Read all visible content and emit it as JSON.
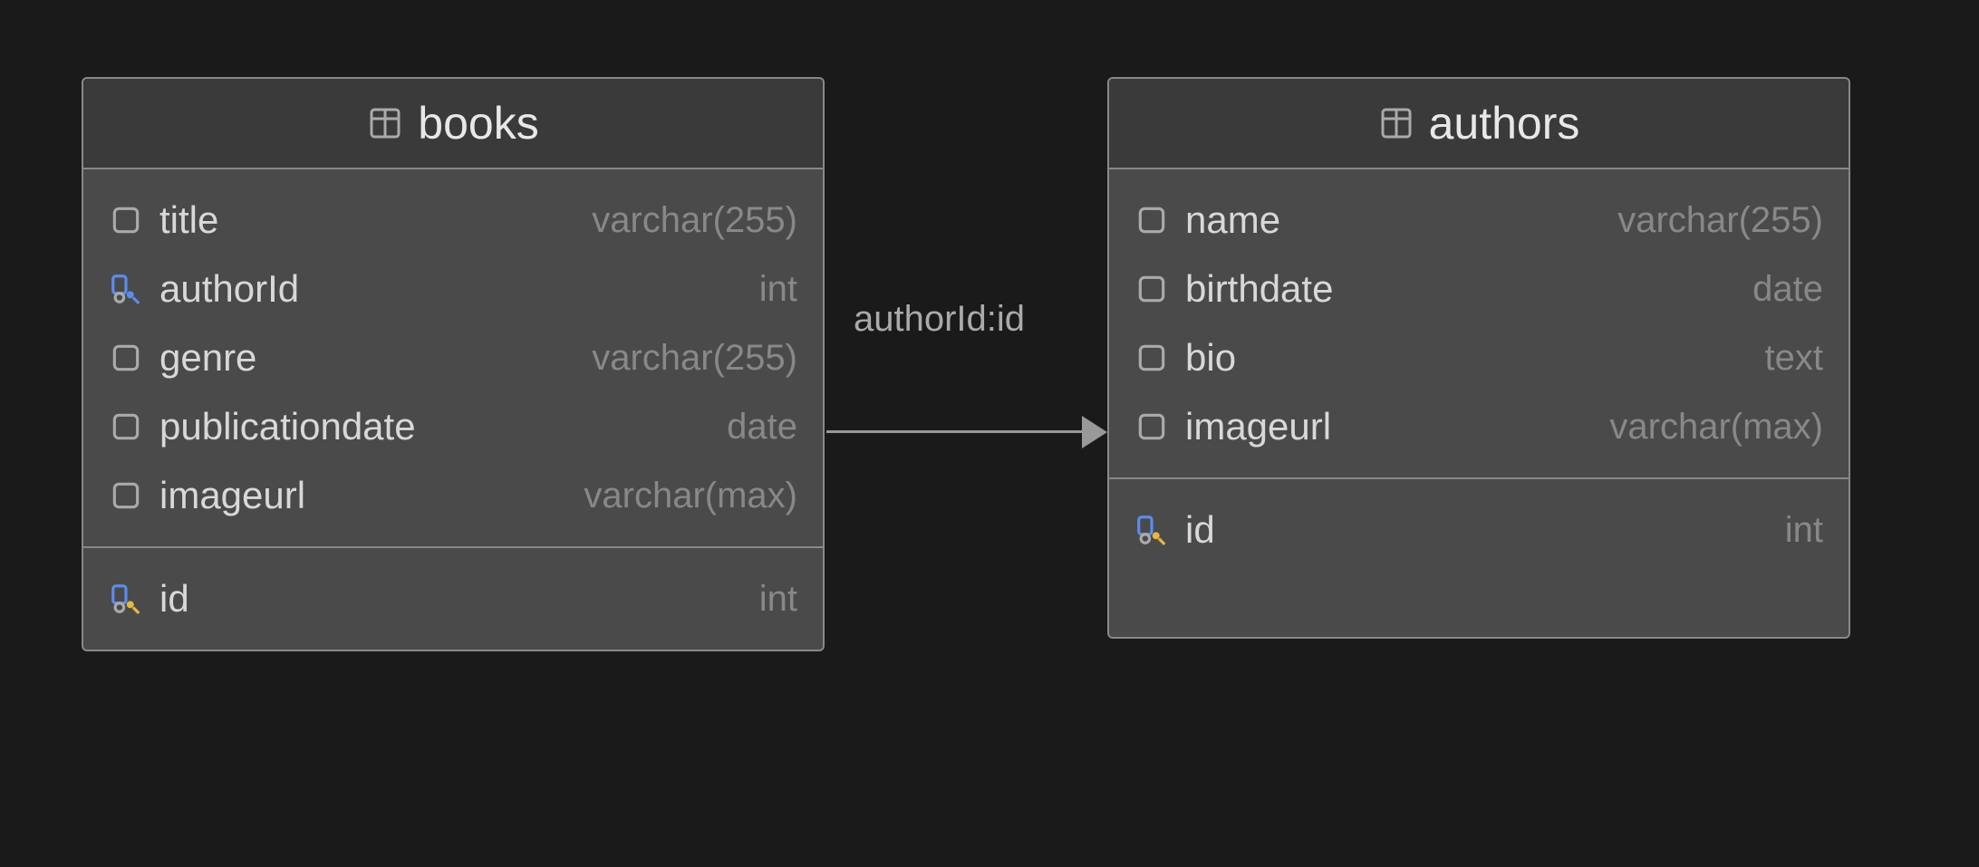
{
  "relationship": {
    "label": "authorId:id"
  },
  "tables": {
    "books": {
      "name": "books",
      "columns": [
        {
          "name": "title",
          "type": "varchar(255)",
          "icon": "column"
        },
        {
          "name": "authorId",
          "type": "int",
          "icon": "fk"
        },
        {
          "name": "genre",
          "type": "varchar(255)",
          "icon": "column"
        },
        {
          "name": "publicationdate",
          "type": "date",
          "icon": "column"
        },
        {
          "name": "imageurl",
          "type": "varchar(max)",
          "icon": "column"
        }
      ],
      "keys": [
        {
          "name": "id",
          "type": "int",
          "icon": "pk"
        }
      ]
    },
    "authors": {
      "name": "authors",
      "columns": [
        {
          "name": "name",
          "type": "varchar(255)",
          "icon": "column"
        },
        {
          "name": "birthdate",
          "type": "date",
          "icon": "column"
        },
        {
          "name": "bio",
          "type": "text",
          "icon": "column"
        },
        {
          "name": "imageurl",
          "type": "varchar(max)",
          "icon": "column"
        }
      ],
      "keys": [
        {
          "name": "id",
          "type": "int",
          "icon": "pk"
        }
      ]
    }
  }
}
